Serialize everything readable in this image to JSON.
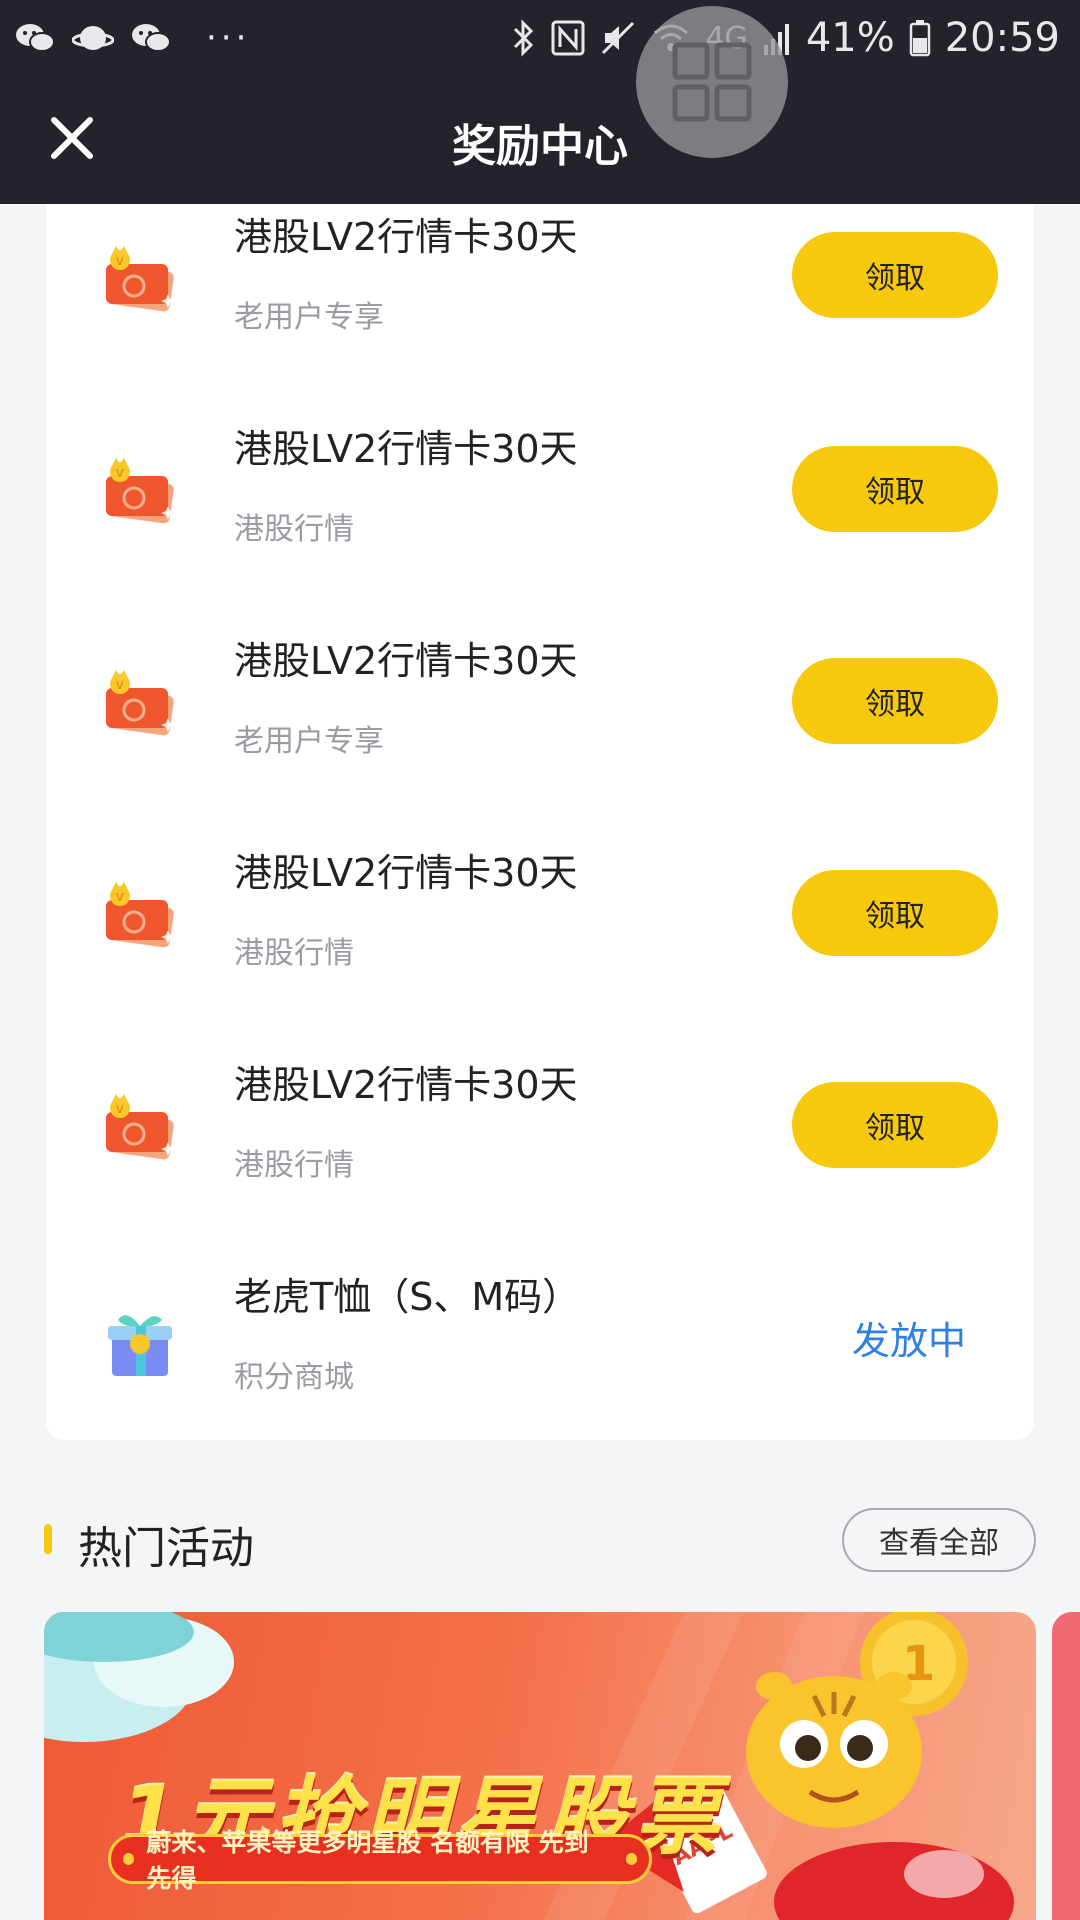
{
  "status_bar": {
    "battery": "41%",
    "time": "20:59",
    "network": "4G",
    "icons": [
      "wechat-icon",
      "saturn-icon",
      "wechat-icon",
      "bluetooth-icon",
      "nfc-icon",
      "mute-icon",
      "wifi-icon",
      "signal-icon",
      "battery-icon"
    ]
  },
  "header": {
    "title": "奖励中心",
    "close_icon": "close-icon"
  },
  "rewards": [
    {
      "title": "港股LV2行情卡30天",
      "subtitle": "老用户专享",
      "action": "领取",
      "icon": "vip-card-icon"
    },
    {
      "title": "港股LV2行情卡30天",
      "subtitle": "港股行情",
      "action": "领取",
      "icon": "vip-card-icon"
    },
    {
      "title": "港股LV2行情卡30天",
      "subtitle": "老用户专享",
      "action": "领取",
      "icon": "vip-card-icon"
    },
    {
      "title": "港股LV2行情卡30天",
      "subtitle": "港股行情",
      "action": "领取",
      "icon": "vip-card-icon"
    },
    {
      "title": "港股LV2行情卡30天",
      "subtitle": "港股行情",
      "action": "领取",
      "icon": "vip-card-icon"
    },
    {
      "title": "老虎T恤（S、M码）",
      "subtitle": "积分商城",
      "status": "发放中",
      "icon": "gift-box-icon"
    }
  ],
  "hot_activities": {
    "title": "热门活动",
    "view_all": "查看全部",
    "banner": {
      "headline": "1元抢明星股票",
      "tagline": "蔚来、苹果等更多明星股 名额有限 先到先得",
      "ticket_label": "AAPL"
    }
  },
  "colors": {
    "header_bg": "#22232b",
    "accent": "#f7c90c",
    "status_blue": "#2e7fe6",
    "banner_red": "#ee5a37"
  }
}
